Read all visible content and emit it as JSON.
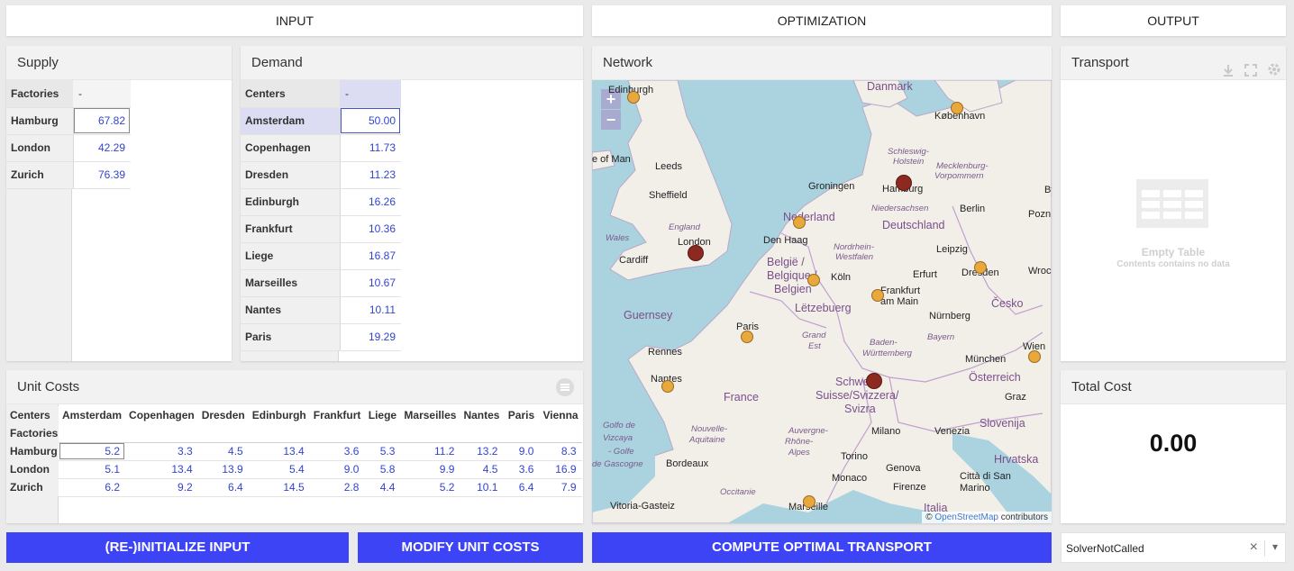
{
  "headers": {
    "input": "INPUT",
    "optimization": "OPTIMIZATION",
    "output": "OUTPUT"
  },
  "supply": {
    "title": "Supply",
    "corner": "Factories",
    "dash": "-",
    "rows": [
      {
        "name": "Hamburg",
        "value": "67.82"
      },
      {
        "name": "London",
        "value": "42.29"
      },
      {
        "name": "Zurich",
        "value": "76.39"
      }
    ]
  },
  "demand": {
    "title": "Demand",
    "corner": "Centers",
    "dash": "-",
    "rows": [
      {
        "name": "Amsterdam",
        "value": "50.00"
      },
      {
        "name": "Copenhagen",
        "value": "11.73"
      },
      {
        "name": "Dresden",
        "value": "11.23"
      },
      {
        "name": "Edinburgh",
        "value": "16.26"
      },
      {
        "name": "Frankfurt",
        "value": "10.36"
      },
      {
        "name": "Liege",
        "value": "16.87"
      },
      {
        "name": "Marseilles",
        "value": "10.67"
      },
      {
        "name": "Nantes",
        "value": "10.11"
      },
      {
        "name": "Paris",
        "value": "19.29"
      }
    ]
  },
  "unit_costs": {
    "title": "Unit Costs",
    "corner_top": "Centers",
    "corner_bottom": "Factories",
    "columns": [
      "Amsterdam",
      "Copenhagen",
      "Dresden",
      "Edinburgh",
      "Frankfurt",
      "Liege",
      "Marseilles",
      "Nantes",
      "Paris",
      "Vienna"
    ],
    "rows": [
      {
        "name": "Hamburg",
        "values": [
          "5.2",
          "3.3",
          "4.5",
          "13.4",
          "3.6",
          "5.3",
          "11.2",
          "13.2",
          "9.0",
          "8.3"
        ]
      },
      {
        "name": "London",
        "values": [
          "5.1",
          "13.4",
          "13.9",
          "5.4",
          "9.0",
          "5.8",
          "9.9",
          "4.5",
          "3.6",
          "16.9"
        ]
      },
      {
        "name": "Zurich",
        "values": [
          "6.2",
          "9.2",
          "6.4",
          "14.5",
          "2.8",
          "4.4",
          "5.2",
          "10.1",
          "6.4",
          "7.9"
        ]
      }
    ]
  },
  "network": {
    "title": "Network",
    "zoom_in": "+",
    "zoom_out": "−",
    "attribution_symbol": "©",
    "attribution_link": "OpenStreetMap",
    "attribution_text": "contributors",
    "labels": {
      "danmark": "Danmark",
      "kobenhavn": "København",
      "edinburgh": "Edinburgh",
      "isle_of_man": "e of Man",
      "leeds": "Leeds",
      "sheffield": "Sheffield",
      "england": "England",
      "wales": "Wales",
      "london": "London",
      "cardiff": "Cardiff",
      "schleswig": "Schleswig-",
      "holstein": "Holstein",
      "mecklenburg": "Mecklenburg-",
      "vorpommern": "Vorpommern",
      "hamburg": "Hamburg",
      "groningen": "Groningen",
      "nederland": "Nederland",
      "niedersachsen": "Niedersachsen",
      "berlin": "Berlin",
      "poznan": "Pozn",
      "by": "By",
      "deutschland": "Deutschland",
      "den_haag": "Den Haag",
      "nordrhein": "Nordrhein-",
      "westfalen": "Westfalen",
      "leipzig": "Leipzig",
      "belgie1": "België /",
      "belgie2": "Belgique /",
      "belgie3": "Belgien",
      "koln": "Köln",
      "erfurt": "Erfurt",
      "dresden": "Dresden",
      "wroc": "Wroc",
      "frankfurt1": "Frankfurt",
      "frankfurt2": "am Main",
      "cesko": "Česko",
      "letzebuerg": "Lëtzebuerg",
      "nurnberg": "Nürnberg",
      "guernsey": "Guernsey",
      "paris": "Paris",
      "grand_est1": "Grand",
      "grand_est2": "Est",
      "bayern": "Bayern",
      "rennes": "Rennes",
      "baden1": "Baden-",
      "baden2": "Württemberg",
      "munchen": "München",
      "wien": "Wien",
      "nantes": "Nantes",
      "osterreich": "Österreich",
      "schweiz1": "Schweiz/",
      "schweiz2": "Suisse/Svizzera/",
      "schweiz3": "Svizra",
      "france": "France",
      "graz": "Graz",
      "golfo1": "Golfo de",
      "golfo2": "Vizcaya",
      "golfo3": "- Golfe",
      "golfo4": "de Gascogne",
      "nouvelle1": "Nouvelle-",
      "nouvelle2": "Aquitaine",
      "auvergne1": "Auvergne-",
      "auvergne2": "Rhône-",
      "auvergne3": "Alpes",
      "slovenija": "Slovenija",
      "milano": "Milano",
      "venezia": "Venezia",
      "hrvatska": "Hrvatska",
      "bordeaux": "Bordeaux",
      "torino": "Torino",
      "genova": "Genova",
      "monaco": "Monaco",
      "firenze": "Firenze",
      "citta1": "Città di San",
      "citta2": "Marino",
      "occitanie": "Occitanie",
      "vitoria": "Vitoria-Gasteiz",
      "marseille": "Marseille",
      "italia": "Italia"
    }
  },
  "transport": {
    "title": "Transport",
    "empty_title": "Empty Table",
    "empty_sub": "Contents contains no data"
  },
  "total_cost": {
    "title": "Total Cost",
    "value": "0.00"
  },
  "buttons": {
    "reinit": "(RE-)INITIALIZE INPUT",
    "modify": "MODIFY UNIT COSTS",
    "compute": "COMPUTE OPTIMAL TRANSPORT"
  },
  "status": {
    "value": "SolverNotCalled",
    "clear": "×",
    "arrow": "▾"
  },
  "colors": {
    "accent": "#3d44f5",
    "value_text": "#3344cc",
    "factory_dot": "#8c2a22",
    "center_dot": "#e9a83c",
    "sea": "#aad3df",
    "land": "#f2efe9"
  }
}
